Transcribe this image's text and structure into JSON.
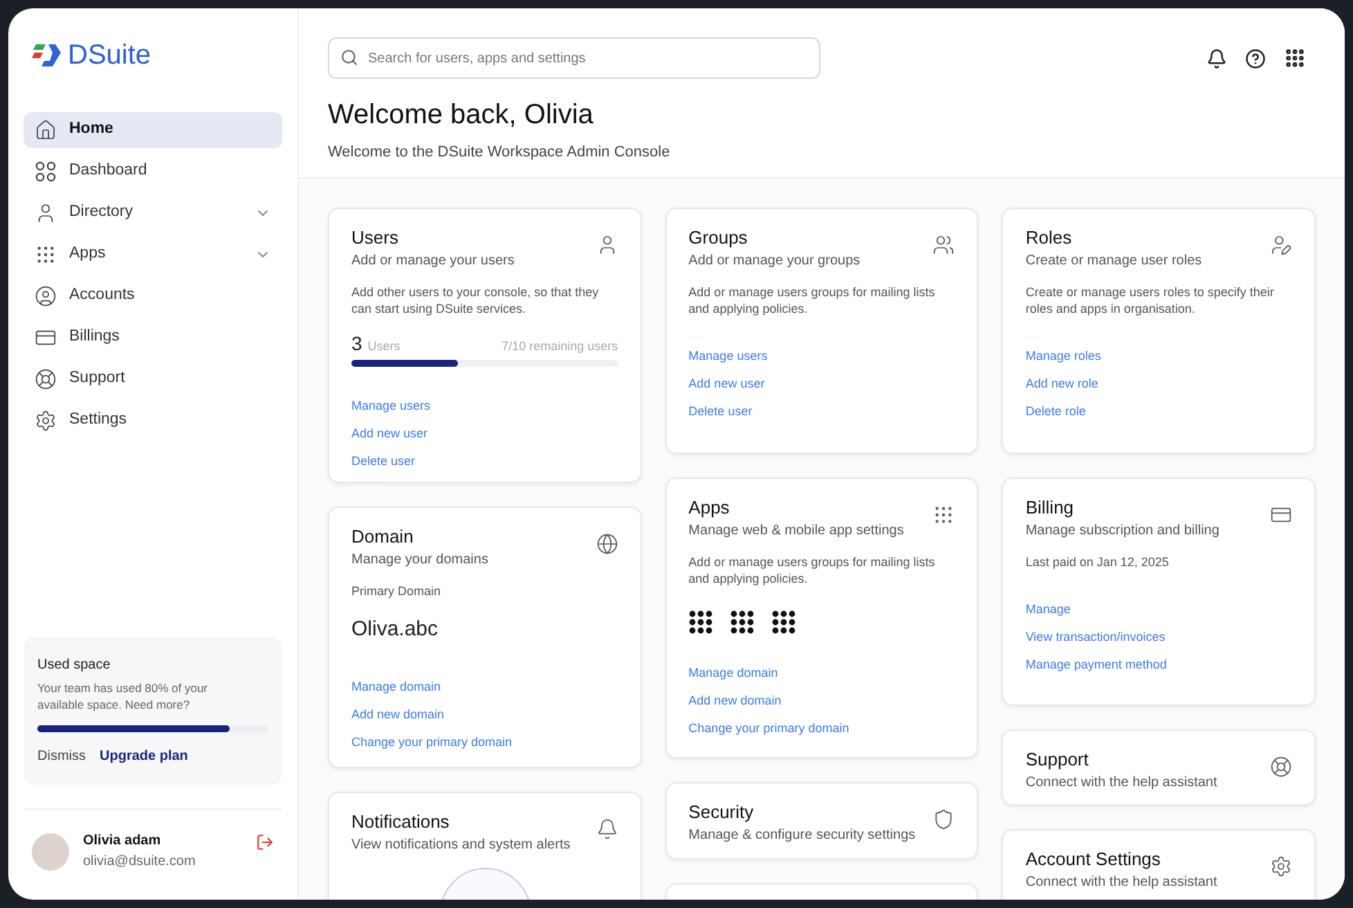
{
  "sidebar": {
    "logo": "DSuite",
    "items": [
      {
        "kind": "home",
        "label": "Home",
        "selected": true
      },
      {
        "kind": "dashboard",
        "label": "Dashboard",
        "selected": false
      },
      {
        "kind": "directory",
        "label": "Directory",
        "selected": false,
        "expanded": false
      },
      {
        "kind": "apps",
        "label": "Apps",
        "selected": false,
        "expanded": false
      },
      {
        "kind": "accounts",
        "label": "Accounts",
        "selected": false
      },
      {
        "kind": "billings",
        "label": "Billings",
        "selected": false
      },
      {
        "kind": "support",
        "label": "Support",
        "selected": false
      },
      {
        "kind": "settings",
        "label": "Settings",
        "selected": false
      }
    ],
    "storage": {
      "title": "Used space",
      "text": "Your team has used 80% of your available space. Need more?",
      "level": 0.83,
      "dismiss": "Dismiss",
      "upgrade": "Upgrade plan"
    },
    "user": {
      "name": "Olivia adam",
      "email": "olivia@dsuite.com"
    }
  },
  "search": {
    "placeholder": "Search for users, apps and settings"
  },
  "header": {
    "title": "Welcome back, Olivia",
    "subtitle": "Welcome to the DSuite Workspace Admin Console"
  },
  "columns": [
    [
      {
        "kind": "users",
        "title": "Users",
        "subtitle": "Add or manage your users",
        "description": "Add other users to your console, so that they can start using DSuite services.",
        "usage": {
          "count": "3",
          "unit": "Users",
          "remaining": "7/10 remaining users",
          "level": 0.4
        },
        "links": [
          "Manage users",
          "Add new user",
          "Delete user"
        ]
      },
      {
        "kind": "domain",
        "title": "Domain",
        "subtitle": "Manage your domains",
        "field_label": "Primary Domain",
        "field_value": "Oliva.abc",
        "links": [
          "Manage domain",
          "Add new domain",
          "Change your primary domain"
        ]
      },
      {
        "kind": "notifications",
        "title": "Notifications",
        "subtitle": "View notifications and system alerts"
      }
    ],
    [
      {
        "kind": "groups",
        "title": "Groups",
        "subtitle": "Add or manage your groups",
        "description": "Add or manage users groups for mailing lists and applying policies.",
        "links": [
          "Manage users",
          "Add new user",
          "Delete user"
        ]
      },
      {
        "kind": "apps",
        "title": "Apps",
        "subtitle": "Manage web & mobile app settings",
        "description": "Add or manage users groups for mailing lists and applying policies.",
        "links": [
          "Manage domain",
          "Add new domain",
          "Change your primary domain"
        ]
      },
      {
        "kind": "security",
        "title": "Security",
        "subtitle": "Manage & configure security settings"
      },
      {
        "kind": "blank"
      }
    ],
    [
      {
        "kind": "roles",
        "title": "Roles",
        "subtitle": "Create or manage user roles",
        "description": "Create or manage users roles to specify their roles and apps in organisation.",
        "links": [
          "Manage roles",
          "Add new role",
          "Delete role"
        ]
      },
      {
        "kind": "billing",
        "title": "Billing",
        "subtitle": "Manage subscription and billing",
        "field_label": "Last paid on Jan 12, 2025",
        "links": [
          "Manage",
          "View transaction/invoices",
          "Manage payment method"
        ]
      },
      {
        "kind": "support",
        "title": "Support",
        "subtitle": "Connect with the help assistant"
      },
      {
        "kind": "settings",
        "title": "Account Settings",
        "subtitle": "Connect with the help assistant"
      }
    ]
  ]
}
